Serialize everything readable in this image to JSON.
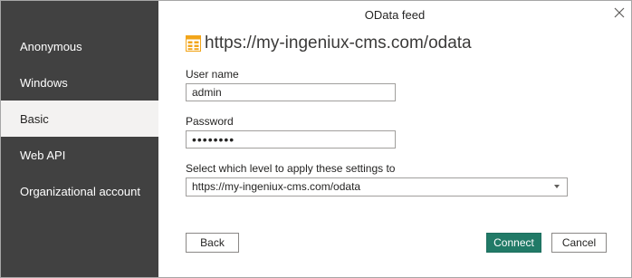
{
  "dialog": {
    "title": "OData feed",
    "url": "https://my-ingeniux-cms.com/odata"
  },
  "sidebar": {
    "items": [
      {
        "label": "Anonymous",
        "selected": false
      },
      {
        "label": "Windows",
        "selected": false
      },
      {
        "label": "Basic",
        "selected": true
      },
      {
        "label": "Web API",
        "selected": false
      },
      {
        "label": "Organizational account",
        "selected": false
      }
    ]
  },
  "form": {
    "username_label": "User name",
    "username_value": "admin",
    "password_label": "Password",
    "password_value": "••••••••",
    "level_label": "Select which level to apply these settings to",
    "level_selected": "https://my-ingeniux-cms.com/odata"
  },
  "buttons": {
    "back": "Back",
    "connect": "Connect",
    "cancel": "Cancel"
  },
  "icons": {
    "feed": "odata-feed-icon",
    "close": "close-icon",
    "dropdown": "chevron-down-icon"
  },
  "colors": {
    "sidebar_bg": "#414141",
    "selected_item_bg": "#f3f2f1",
    "primary_button": "#217a67",
    "feed_icon": "#f2a51a"
  }
}
